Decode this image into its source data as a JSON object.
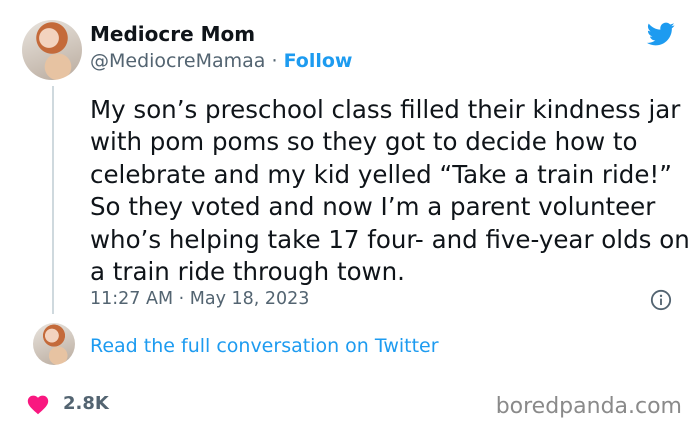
{
  "author": {
    "name": "Mediocre Mom",
    "handle": "@MediocreMamaa",
    "separator": "·",
    "follow_label": "Follow"
  },
  "tweet": {
    "text": "My son’s preschool class filled their kindness jar with pom poms so they got to decide how to celebrate and my kid yelled “Take a train ride!” So they voted and now I’m a parent volunteer who’s helping take 17 four- and five-year olds on a train ride through town.",
    "timestamp": "11:27 AM · May 18, 2023"
  },
  "conversation_link": "Read the full conversation on Twitter",
  "likes": "2.8K",
  "watermark": "boredpanda.com",
  "icons": {
    "brand": "twitter-bird-icon",
    "info": "info-icon",
    "like": "heart-icon"
  },
  "colors": {
    "accent": "#1d9bf0",
    "heart": "#f91880",
    "text": "#0f1419",
    "muted": "#536471"
  }
}
